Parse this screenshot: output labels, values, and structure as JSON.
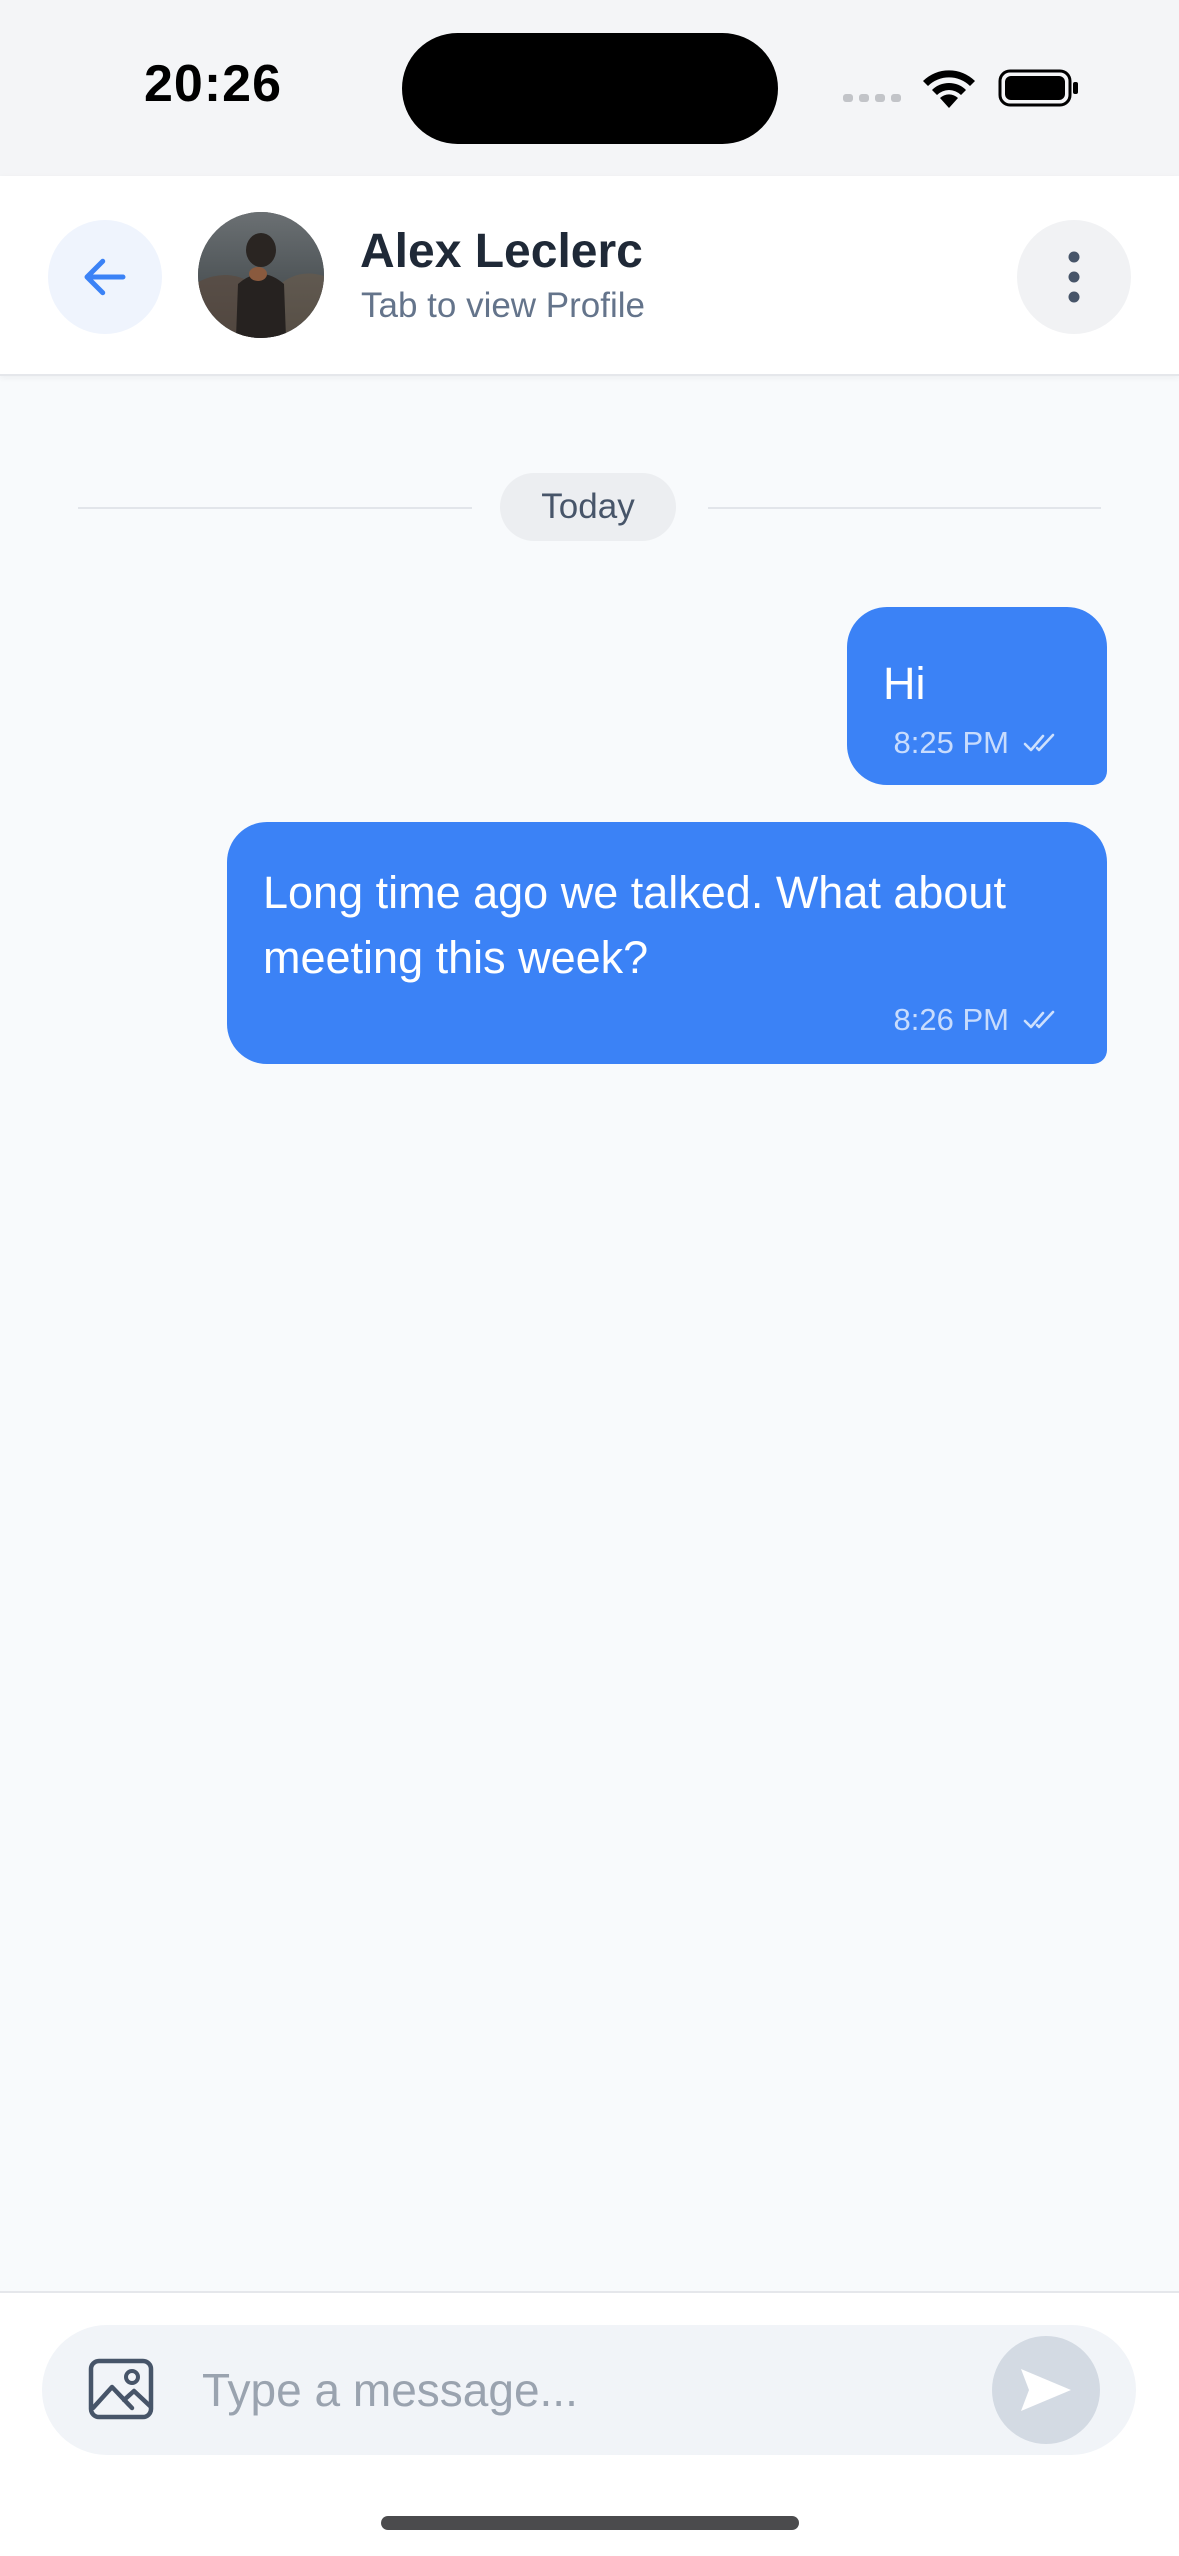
{
  "status_bar": {
    "time": "20:26"
  },
  "header": {
    "contact_name": "Alex Leclerc",
    "subtitle": "Tab to view Profile",
    "icons": [
      "arrow-left-icon",
      "more-vertical-icon"
    ]
  },
  "conversation": {
    "date_label": "Today",
    "messages": [
      {
        "text": "Hi",
        "time": "8:25 PM",
        "status": "read",
        "direction": "outgoing"
      },
      {
        "text": "Long time ago we talked. What about meeting this week?",
        "time": "8:26 PM",
        "status": "read",
        "direction": "outgoing"
      }
    ]
  },
  "composer": {
    "placeholder": "Type a message...",
    "value": "",
    "icons": [
      "image-icon",
      "send-icon"
    ]
  },
  "colors": {
    "accent": "#3b82f6",
    "background": "#f8fafc",
    "header_bg": "#ffffff",
    "send_disabled": "#d3dae3"
  }
}
